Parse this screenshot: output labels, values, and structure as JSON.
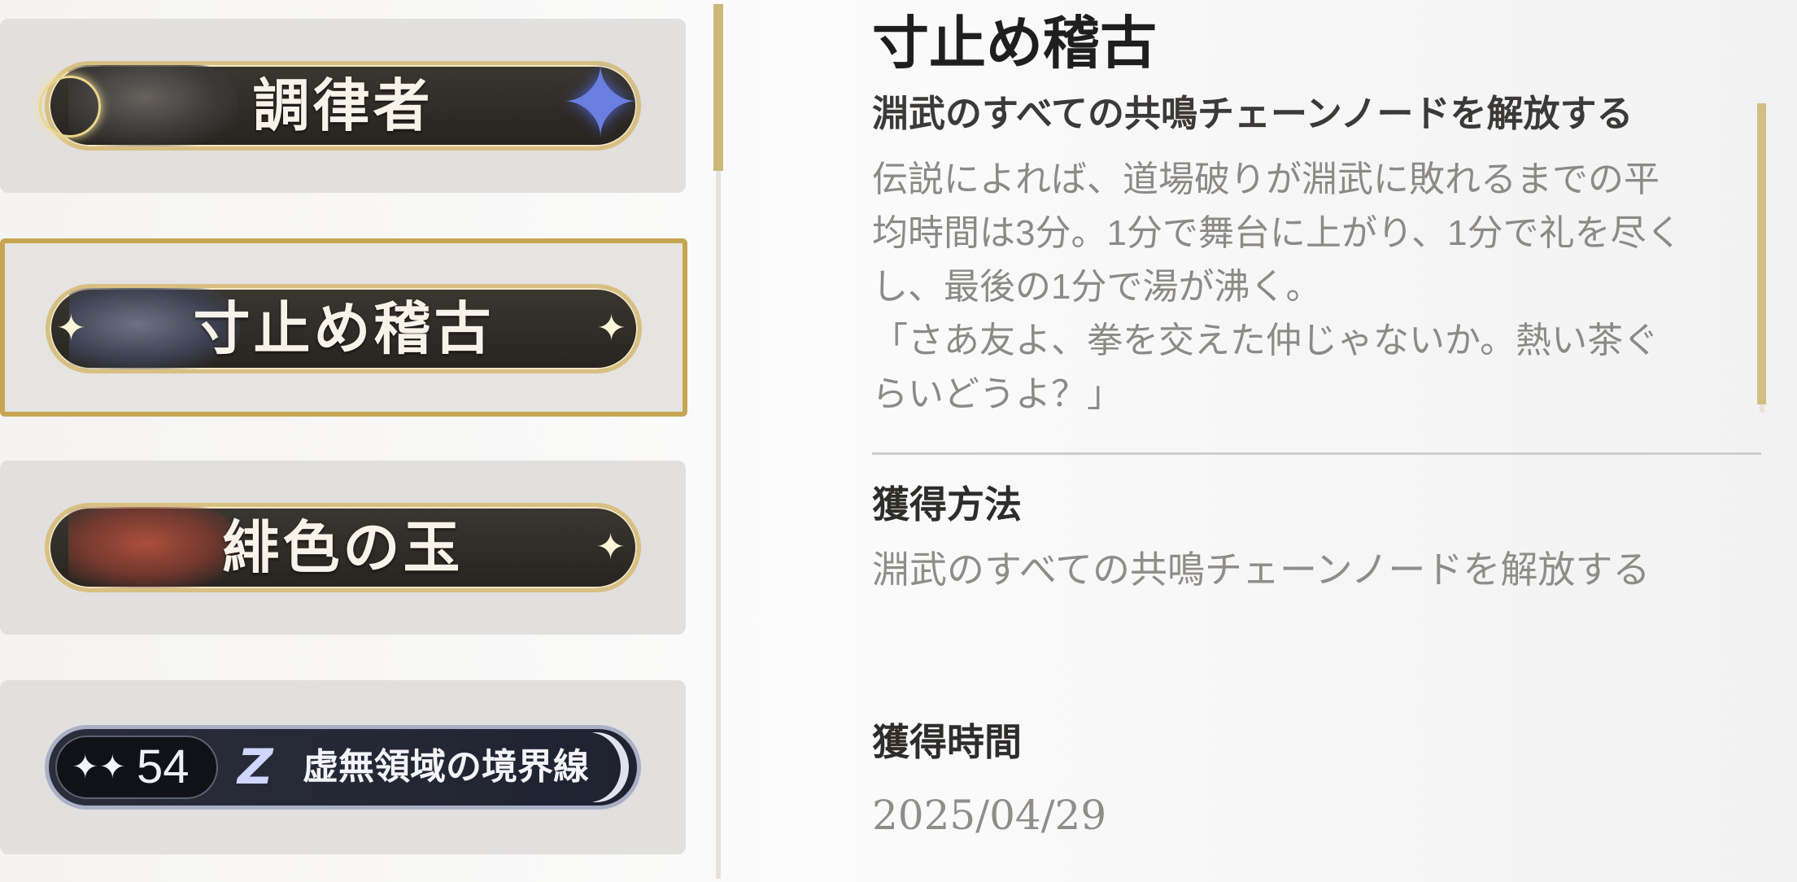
{
  "titles_list": [
    {
      "name": "調律者"
    },
    {
      "name": "寸止め稽古"
    },
    {
      "name": "緋色の玉"
    }
  ],
  "rank_card": {
    "level": "54",
    "name": "虚無領域の境界線"
  },
  "detail": {
    "title": "寸止め稽古",
    "subtitle": "淵武のすべての共鳴チェーンノードを解放する",
    "description": "伝説によれば、道場破りが淵武に敗れるまでの平\n均時間は3分。1分で舞台に上がり、1分で礼を尽く\nし、最後の1分で湯が沸く。\n「さあ友よ、拳を交えた仲じゃないか。熱い茶ぐ\nらいどうよ？」",
    "acquire_method_label": "獲得方法",
    "acquire_method_value": "淵武のすべての共鳴チェーンノードを解放する",
    "acquire_time_label": "獲得時間",
    "acquire_time_value": "2025/04/29"
  },
  "colors": {
    "selected_border": "#c6a653",
    "scroll_thumb": "#cdb977",
    "plate_dark": "#27241f",
    "plate_rim": "#d8c083"
  },
  "icons": {
    "sparkle": "sparkle-icon",
    "star_flower": "star-flower-icon",
    "z_mark": "zz-icon"
  }
}
